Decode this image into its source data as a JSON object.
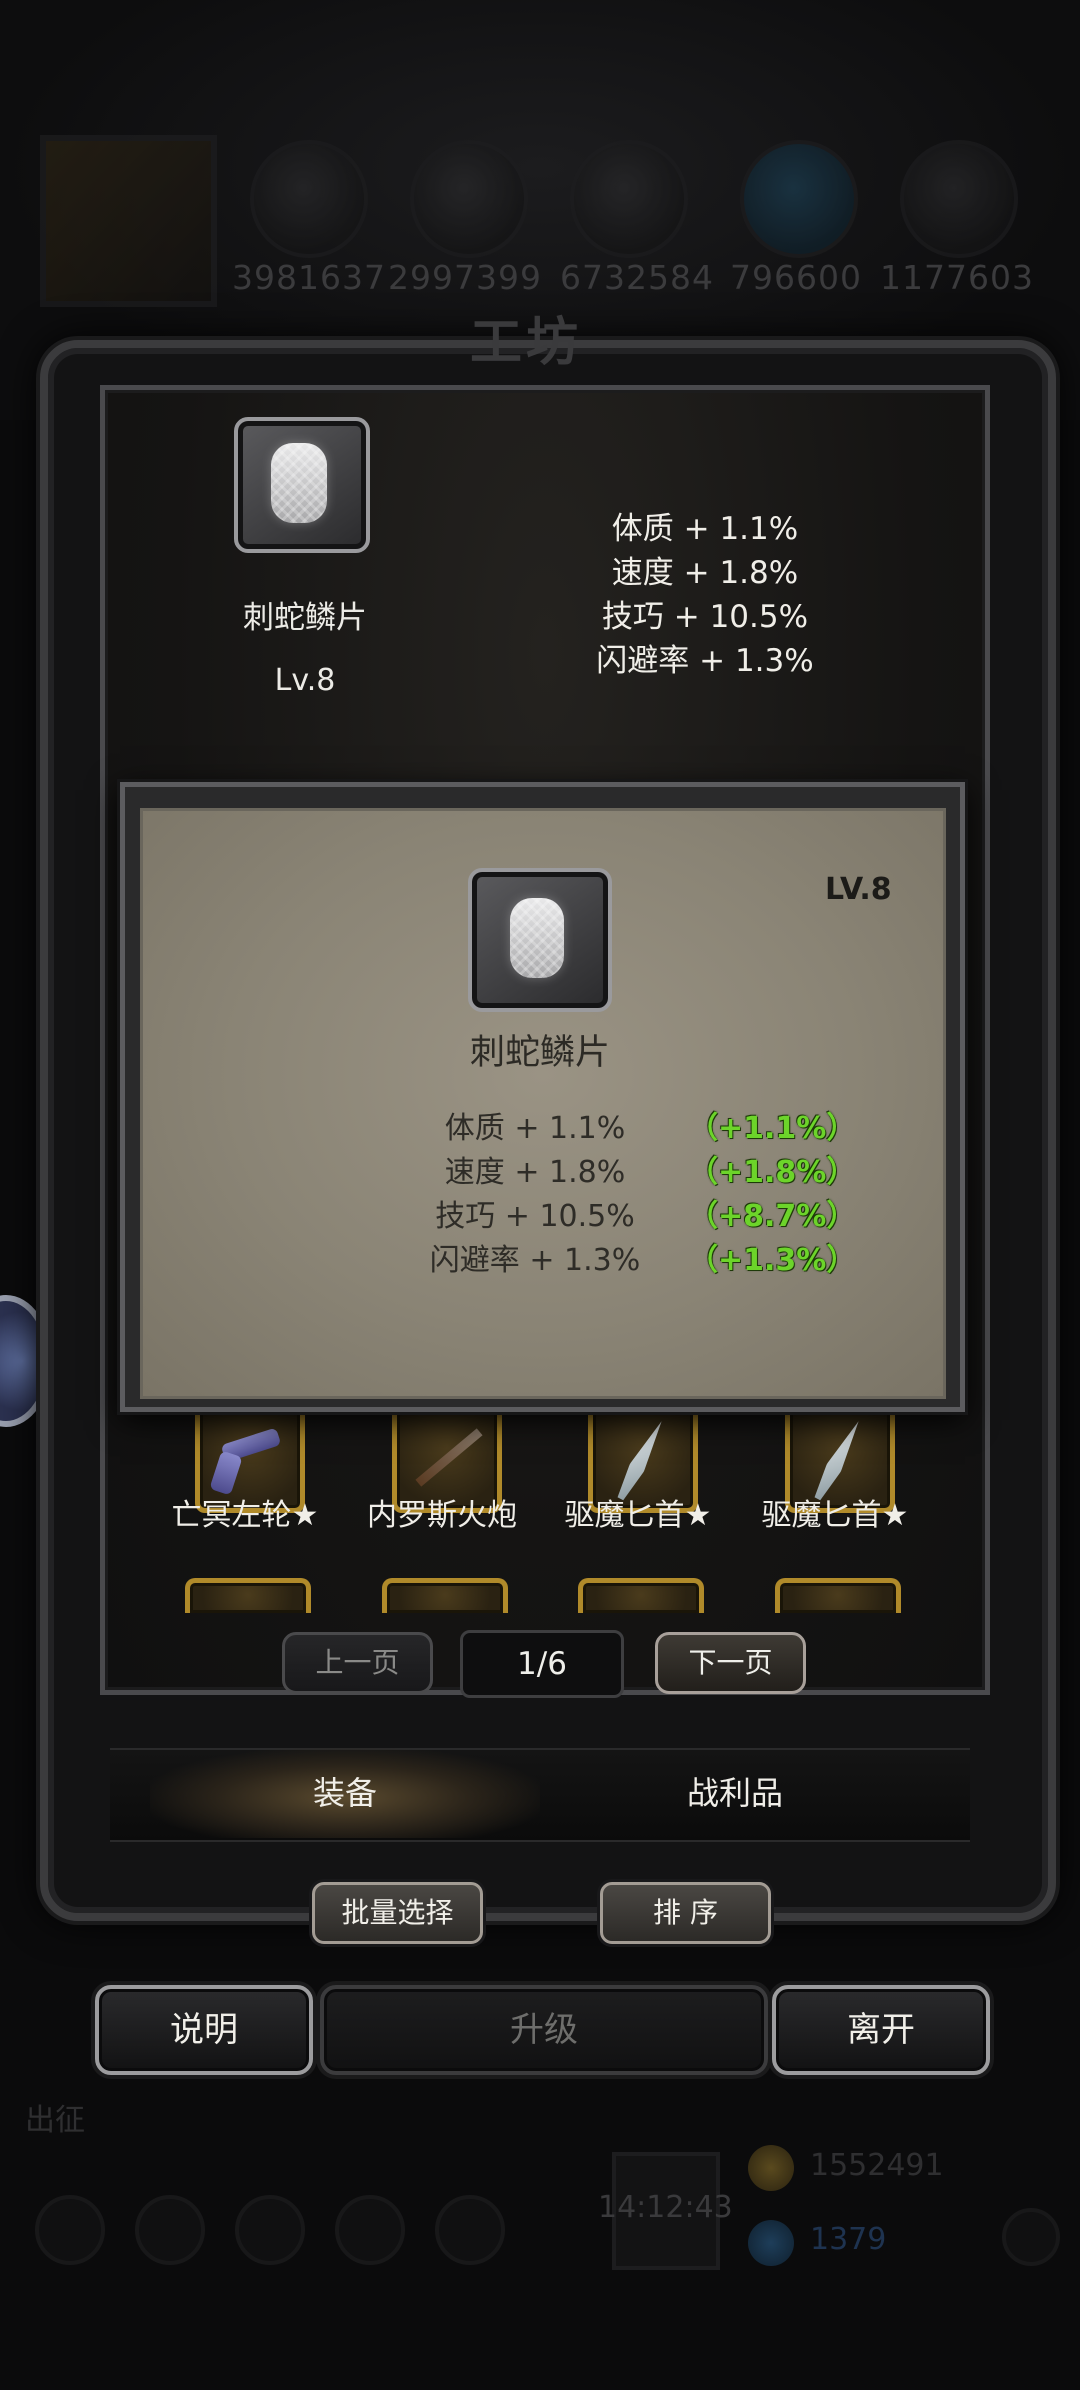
{
  "background": {
    "resources": [
      "3981637",
      "2997399",
      "6732584",
      "796600",
      "1177603"
    ],
    "title": "工坊",
    "bottom_label": "出征",
    "gold": "1552491",
    "gems": "1379",
    "clock": "14:12:43"
  },
  "header": {
    "item_name": "刺蛇鳞片",
    "item_level": "Lv.8",
    "stats": [
      "体质 + 1.1%",
      "速度 + 1.8%",
      "技巧 + 10.5%",
      "闪避率 + 1.3%"
    ]
  },
  "detail_card": {
    "level": "LV.8",
    "item_name": "刺蛇鳞片",
    "stats": [
      {
        "label": "体质 + 1.1%",
        "bonus": "（+1.1%）"
      },
      {
        "label": "速度 + 1.8%",
        "bonus": "（+1.8%）"
      },
      {
        "label": "技巧 + 10.5%",
        "bonus": "（+8.7%）"
      },
      {
        "label": "闪避率 + 1.3%",
        "bonus": "（+1.3%）"
      }
    ]
  },
  "items": [
    {
      "name": "亡冥左轮★",
      "icon": "revolver-icon"
    },
    {
      "name": "内罗斯火炮",
      "icon": "musket-icon"
    },
    {
      "name": "驱魔匕首★",
      "icon": "dagger-icon"
    },
    {
      "name": "驱魔匕首★",
      "icon": "dagger-icon"
    }
  ],
  "pager": {
    "prev": "上一页",
    "indicator": "1/6",
    "next": "下一页"
  },
  "tabs": [
    "装备",
    "战利品"
  ],
  "tools": {
    "batch": "批量选择",
    "sort": "排 序"
  },
  "actions": {
    "help": "说明",
    "upgrade": "升级",
    "leave": "离开"
  },
  "colors": {
    "bonus_green": "#6cd42a",
    "gold_border": "#b08a2a",
    "card_parchment": "#8a8475"
  }
}
